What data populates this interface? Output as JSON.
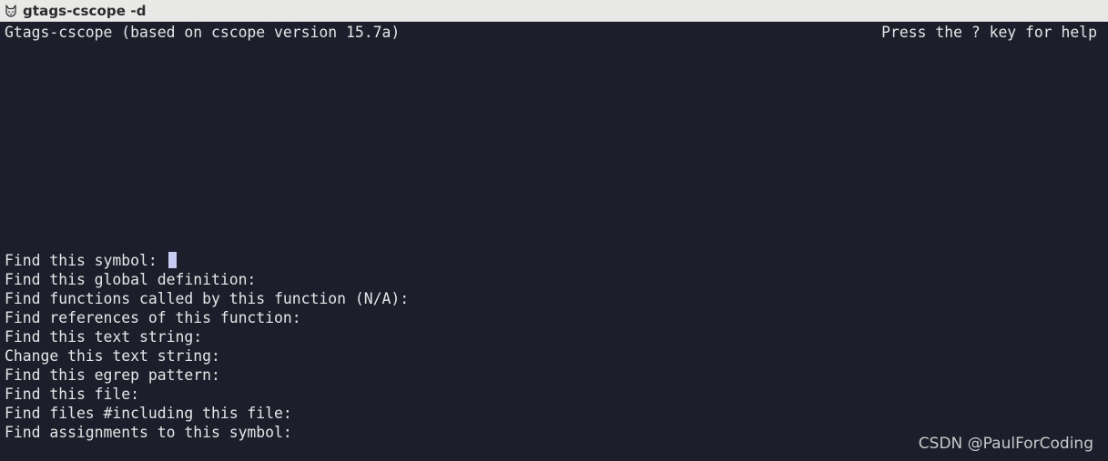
{
  "window": {
    "title": "gtags-cscope -d",
    "icon": "cat-icon"
  },
  "terminal": {
    "header_left": "Gtags-cscope (based on cscope version 15.7a)",
    "header_right": "Press the ? key for help",
    "prompts": [
      "Find this symbol: ",
      "Find this global definition:",
      "Find functions called by this function (N/A):",
      "Find references of this function:",
      "Find this text string:",
      "Change this text string:",
      "Find this egrep pattern:",
      "Find this file:",
      "Find files #including this file:",
      "Find assignments to this symbol:"
    ]
  },
  "watermark": "CSDN @PaulForCoding",
  "colors": {
    "background": "#1c1f2b",
    "foreground": "#e6e6e6",
    "cursor": "#c9ccf2",
    "titlebar": "#e8e8e7"
  }
}
